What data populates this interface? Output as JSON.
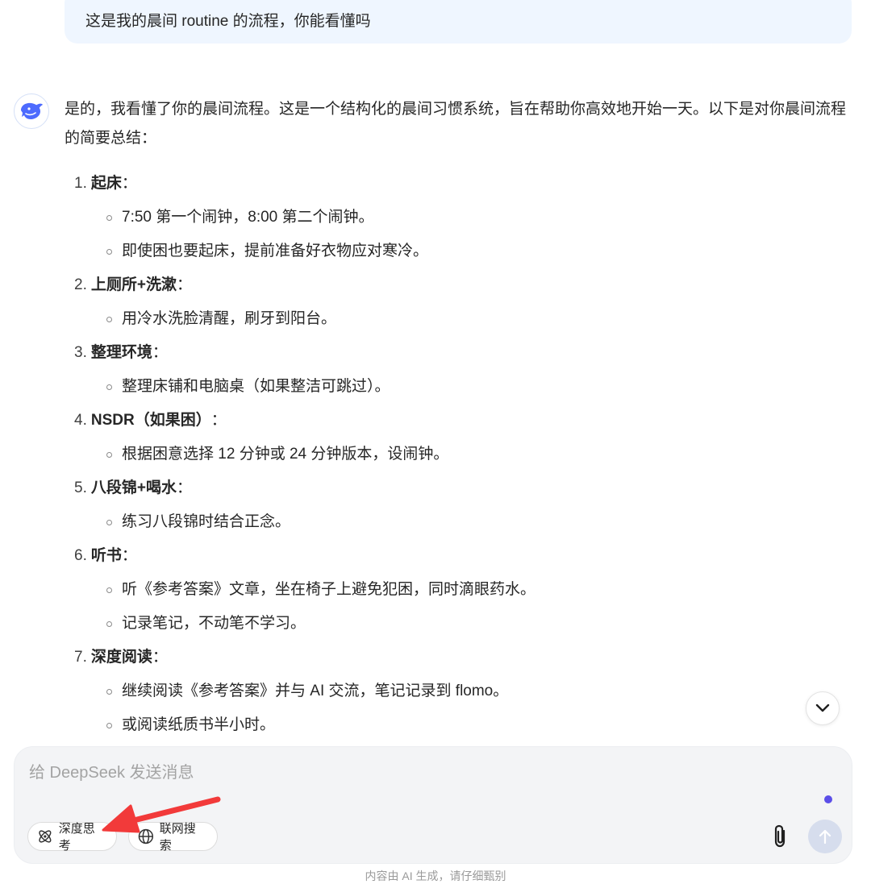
{
  "user_message": "这是我的晨间 routine 的流程，你能看懂吗",
  "assistant": {
    "intro": "是的，我看懂了你的晨间流程。这是一个结构化的晨间习惯系统，旨在帮助你高效地开始一天。以下是对你晨间流程的简要总结：",
    "steps": [
      {
        "num": "1.",
        "title": "起床",
        "colon": "：",
        "subs": [
          "7:50 第一个闹钟，8:00 第二个闹钟。",
          "即使困也要起床，提前准备好衣物应对寒冷。"
        ]
      },
      {
        "num": "2.",
        "title": "上厕所+洗漱",
        "colon": "：",
        "subs": [
          "用冷水洗脸清醒，刷牙到阳台。"
        ]
      },
      {
        "num": "3.",
        "title": "整理环境",
        "colon": "：",
        "subs": [
          "整理床铺和电脑桌（如果整洁可跳过）。"
        ]
      },
      {
        "num": "4.",
        "title": "NSDR（如果困）",
        "colon": "：",
        "subs": [
          "根据困意选择 12 分钟或 24 分钟版本，设闹钟。"
        ]
      },
      {
        "num": "5.",
        "title": "八段锦+喝水",
        "colon": "：",
        "subs": [
          "练习八段锦时结合正念。"
        ]
      },
      {
        "num": "6.",
        "title": "听书",
        "colon": "：",
        "subs": [
          "听《参考答案》文章，坐在椅子上避免犯困，同时滴眼药水。",
          "记录笔记，不动笔不学习。"
        ]
      },
      {
        "num": "7.",
        "title": "深度阅读",
        "colon": "：",
        "subs": [
          "继续阅读《参考答案》并与 AI 交流，笔记记录到 flomo。",
          "或阅读纸质书半小时。"
        ]
      }
    ]
  },
  "composer": {
    "placeholder": "给 DeepSeek 发送消息",
    "deep_think_label": "深度思考",
    "web_search_label": "联网搜索"
  },
  "disclaimer": "内容由 AI 生成，请仔细甄别",
  "colors": {
    "user_bubble": "#eff6ff",
    "brand_blue": "#4d6bfe",
    "accent_purple": "#5b4ee8",
    "annotation_red": "#f23a3a"
  },
  "icons": {
    "avatar": "deepseek-whale-icon",
    "scroll": "chevron-down-icon",
    "deep_think": "atom-icon",
    "web_search": "globe-icon",
    "attach": "paperclip-icon",
    "send": "arrow-up-icon"
  }
}
